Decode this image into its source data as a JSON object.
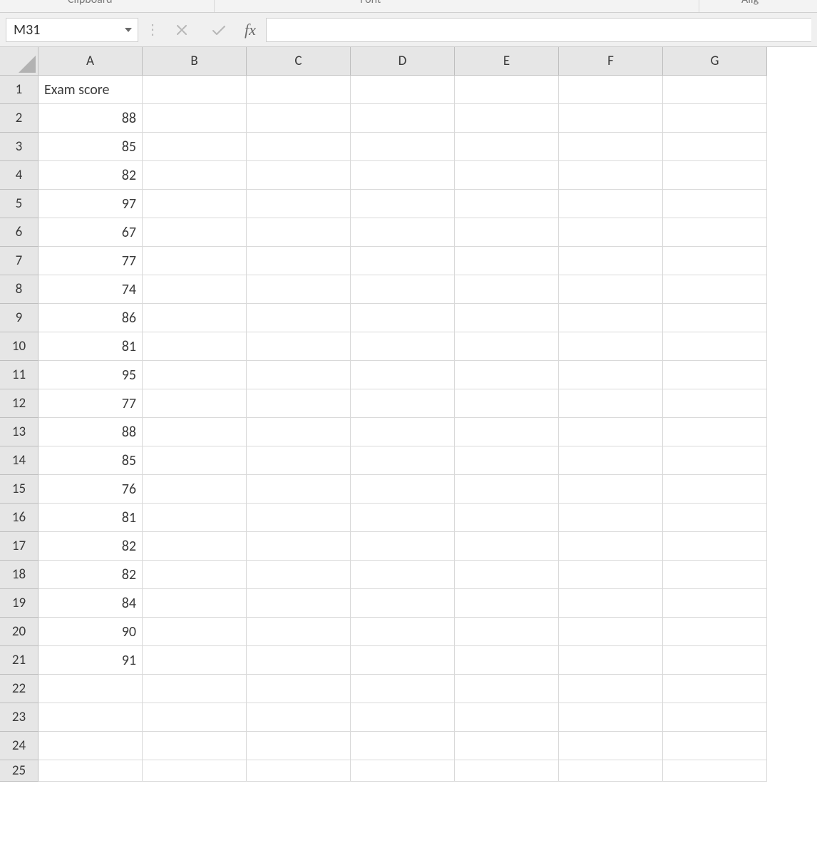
{
  "ribbon_groups": {
    "clipboard": "Clipboard",
    "font": "Font",
    "align": "Alig"
  },
  "name_box": {
    "value": "M31"
  },
  "formula_bar": {
    "fx_label": "fx",
    "value": ""
  },
  "columns": [
    "A",
    "B",
    "C",
    "D",
    "E",
    "F",
    "G"
  ],
  "rows": [
    {
      "n": "1",
      "a": "Exam score",
      "a_type": "text"
    },
    {
      "n": "2",
      "a": "88",
      "a_type": "num"
    },
    {
      "n": "3",
      "a": "85",
      "a_type": "num"
    },
    {
      "n": "4",
      "a": "82",
      "a_type": "num"
    },
    {
      "n": "5",
      "a": "97",
      "a_type": "num"
    },
    {
      "n": "6",
      "a": "67",
      "a_type": "num"
    },
    {
      "n": "7",
      "a": "77",
      "a_type": "num"
    },
    {
      "n": "8",
      "a": "74",
      "a_type": "num"
    },
    {
      "n": "9",
      "a": "86",
      "a_type": "num"
    },
    {
      "n": "10",
      "a": "81",
      "a_type": "num"
    },
    {
      "n": "11",
      "a": "95",
      "a_type": "num"
    },
    {
      "n": "12",
      "a": "77",
      "a_type": "num"
    },
    {
      "n": "13",
      "a": "88",
      "a_type": "num"
    },
    {
      "n": "14",
      "a": "85",
      "a_type": "num"
    },
    {
      "n": "15",
      "a": "76",
      "a_type": "num"
    },
    {
      "n": "16",
      "a": "81",
      "a_type": "num"
    },
    {
      "n": "17",
      "a": "82",
      "a_type": "num"
    },
    {
      "n": "18",
      "a": "82",
      "a_type": "num"
    },
    {
      "n": "19",
      "a": "84",
      "a_type": "num"
    },
    {
      "n": "20",
      "a": "90",
      "a_type": "num"
    },
    {
      "n": "21",
      "a": "91",
      "a_type": "num"
    },
    {
      "n": "22",
      "a": "",
      "a_type": "text"
    },
    {
      "n": "23",
      "a": "",
      "a_type": "text"
    },
    {
      "n": "24",
      "a": "",
      "a_type": "text"
    }
  ],
  "partial_next_row": "25"
}
